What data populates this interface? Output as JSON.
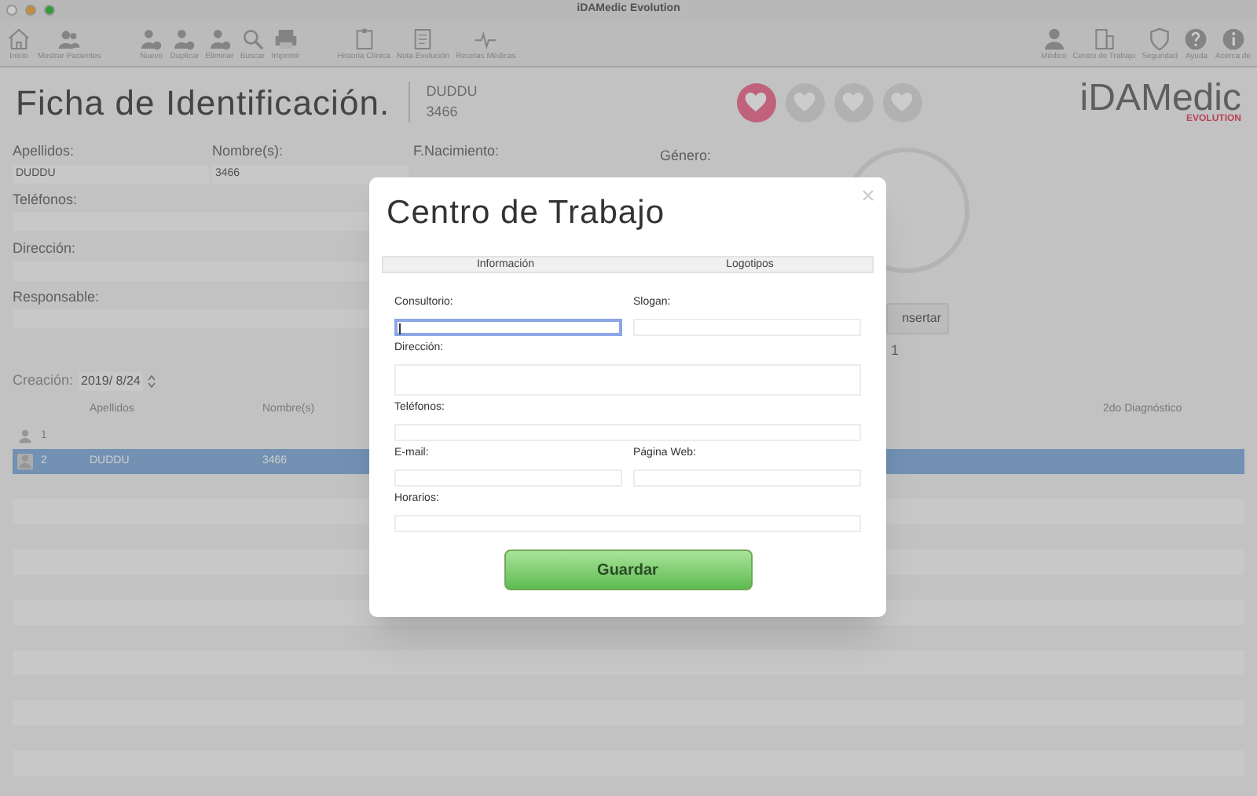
{
  "window": {
    "title": "iDAMedic Evolution"
  },
  "toolbar_left": [
    {
      "kind": "home",
      "label": "Inicio"
    },
    {
      "kind": "people",
      "label": "Mostrar Pacientes"
    },
    {
      "kind": "gap"
    },
    {
      "kind": "add-user",
      "label": "Nuevo"
    },
    {
      "kind": "dup-user",
      "label": "Duplicar"
    },
    {
      "kind": "del-user",
      "label": "Eliminar"
    },
    {
      "kind": "search",
      "label": "Buscar"
    },
    {
      "kind": "print",
      "label": "Imprimir"
    },
    {
      "kind": "gap"
    },
    {
      "kind": "clipboard",
      "label": "Historia Clínica"
    },
    {
      "kind": "doc",
      "label": "Nota Evolución"
    },
    {
      "kind": "pulse",
      "label": "Recetas Médicas"
    }
  ],
  "toolbar_right": [
    {
      "kind": "user",
      "label": "Médico"
    },
    {
      "kind": "building",
      "label": "Centro de Trabajo"
    },
    {
      "kind": "shield",
      "label": "Seguridad"
    },
    {
      "kind": "help",
      "label": "Ayuda"
    },
    {
      "kind": "info",
      "label": "Acerca de"
    }
  ],
  "header": {
    "title": "Ficha de Identificación.",
    "patient_last": "DUDDU",
    "patient_first": "3466",
    "logo_main": "iDAMedic",
    "logo_sub": "EVOLUTION"
  },
  "hearts": [
    {
      "selected": true
    },
    {
      "selected": false
    },
    {
      "selected": false
    },
    {
      "selected": false
    }
  ],
  "form": {
    "apellidos_label": "Apellidos:",
    "apellidos": "DUDDU",
    "nombre_label": "Nombre(s):",
    "nombre": "3466",
    "nacimiento_label": "F.Nacimiento:",
    "genero_label": "Género:",
    "telefonos_label": "Teléfonos:",
    "direccion_label": "Dirección:",
    "responsable_label": "Responsable:",
    "creacion_label": "Creación:",
    "creacion": "2019/ 8/24",
    "insert_button": "nsertar",
    "count": "1"
  },
  "table": {
    "columns": [
      "Apellidos",
      "Nombre(s)",
      "2do Diagnóstico"
    ],
    "rows": [
      {
        "number": "1",
        "apellidos": "",
        "nombre": "",
        "selected": false
      },
      {
        "number": "2",
        "apellidos": "DUDDU",
        "nombre": "3466",
        "selected": true
      }
    ]
  },
  "dialog": {
    "title": "Centro de Trabajo",
    "tabs": [
      {
        "label": "Información"
      },
      {
        "label": "Logotipos"
      }
    ],
    "fields": [
      {
        "label": "Consultorio:",
        "focused": true,
        "kind": "half"
      },
      {
        "label": "Slogan:",
        "focused": false,
        "kind": "half"
      },
      {
        "label": "Dirección:",
        "focused": false,
        "kind": "tall"
      },
      {
        "label": "Teléfonos:",
        "focused": false,
        "kind": "full"
      },
      {
        "label": "E-mail:",
        "focused": false,
        "kind": "half"
      },
      {
        "label": "Página Web:",
        "focused": false,
        "kind": "half"
      },
      {
        "label": "Horarios:",
        "focused": false,
        "kind": "full"
      }
    ],
    "button": "Guardar"
  }
}
